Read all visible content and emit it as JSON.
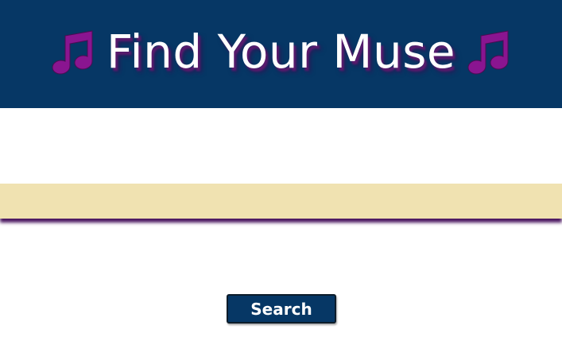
{
  "header": {
    "title": "Find Your Muse",
    "left_icon": "music-note-icon",
    "right_icon": "music-note-icon",
    "background_color": "#063765",
    "icon_color": "#8a1590"
  },
  "search": {
    "value": "",
    "placeholder": "",
    "button_label": "Search",
    "bar_color": "#f0e2b1"
  }
}
